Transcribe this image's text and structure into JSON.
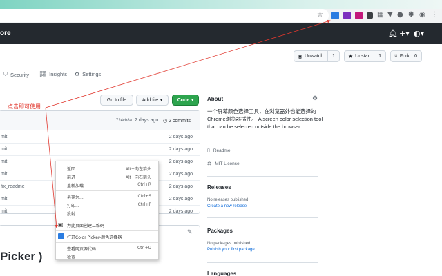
{
  "browser": {
    "star_icon": "star-icon",
    "extensions": [
      {
        "name": "color-picker-extension-icon",
        "color": "#2b7de1"
      },
      {
        "name": "purple-extension-icon",
        "color": "#7b2fbe"
      },
      {
        "name": "magenta-extension-icon",
        "color": "#c2187a"
      },
      {
        "name": "dark-extension-icon",
        "color": "#3c4043"
      }
    ]
  },
  "github": {
    "brand": "ore",
    "bell_icon": "bell-icon",
    "plus_icon": "plus-icon",
    "avatar_icon": "avatar-icon"
  },
  "repo_actions": {
    "unwatch": {
      "label": "Unwatch",
      "count": "1"
    },
    "unstar": {
      "label": "Unstar",
      "count": "1"
    },
    "fork": {
      "label": "Fork",
      "count": "0"
    }
  },
  "repo_tabs": [
    {
      "label": "Security",
      "icon": "shield-icon"
    },
    {
      "label": "Insights",
      "icon": "graph-icon"
    },
    {
      "label": "Settings",
      "icon": "gear-icon"
    }
  ],
  "branch_bar": {
    "goto_file": "Go to file",
    "add_file": "Add file",
    "code": "Code"
  },
  "commit": {
    "hash": "724cb8a",
    "time": "2 days ago",
    "count": "2 commits"
  },
  "files": [
    {
      "message": "mit",
      "time": "2 days ago"
    },
    {
      "message": "mit",
      "time": "2 days ago"
    },
    {
      "message": "mit",
      "time": "2 days ago"
    },
    {
      "message": "mit",
      "time": "2 days ago"
    },
    {
      "message": "fix_readme",
      "time": "2 days ago"
    },
    {
      "message": "mit",
      "time": "2 days ago"
    },
    {
      "message": "mit",
      "time": "2 days ago"
    }
  ],
  "readme_title": "Picker )",
  "about": {
    "title": "About",
    "description": "一个屏幕颜色选择工具，在浏览器外也能选择的Chrome浏览器插件。 A screen color selection tool that can be selected outside the browser",
    "readme": "Readme",
    "license": "MIT License"
  },
  "releases": {
    "title": "Releases",
    "none": "No releases published",
    "create": "Create a new release"
  },
  "packages": {
    "title": "Packages",
    "none": "No packages published",
    "publish": "Publish your first package"
  },
  "languages": {
    "title": "Languages"
  },
  "context_menu": [
    {
      "label": "返回",
      "shortcut": "Alt+向左箭头"
    },
    {
      "label": "前进",
      "shortcut": "Alt+向右箭头"
    },
    {
      "label": "重新加载",
      "shortcut": "Ctrl+R"
    },
    {
      "label": "另存为...",
      "shortcut": "Ctrl+S"
    },
    {
      "label": "打印...",
      "shortcut": "Ctrl+P"
    },
    {
      "label": "投射...",
      "shortcut": ""
    },
    {
      "label": "为此页面创建二维码",
      "shortcut": ""
    },
    {
      "label": "打开Color Picker-颜色选择器",
      "shortcut": ""
    },
    {
      "label": "查看网页源代码",
      "shortcut": "Ctrl+U"
    },
    {
      "label": "检查",
      "shortcut": ""
    }
  ],
  "annotation": {
    "text": "点击即可使用",
    "color": "#e1382f"
  }
}
